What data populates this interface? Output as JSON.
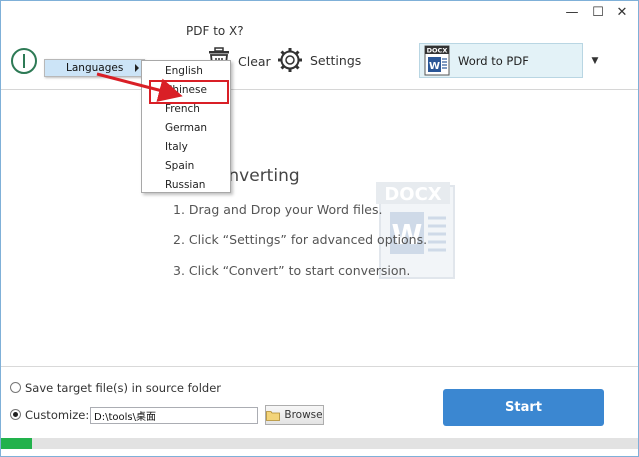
{
  "window": {
    "title": "PDF to X?",
    "minimize_label": "—",
    "maximize_label": "☐",
    "close_label": "✕"
  },
  "toolbar": {
    "clear_label": "Clear",
    "settings_label": "Settings",
    "conversion_selected": "Word to PDF",
    "conversion_icon_text": "DOCX",
    "dropdown_arrow": "▼"
  },
  "menu": {
    "languages_label": "Languages",
    "languages": [
      "English",
      "Chinese",
      "French",
      "German",
      "Italy",
      "Spain",
      "Russian"
    ],
    "highlighted": "Chinese"
  },
  "instructions": {
    "title": "onverting",
    "steps": [
      "1. Drag and Drop your Word files.",
      "2. Click “Settings” for advanced options.",
      "3. Click “Convert” to start conversion."
    ],
    "watermark_text": "DOCX"
  },
  "output": {
    "source_folder_label": "Save target file(s) in source folder",
    "customize_label": "Customize:",
    "customize_selected": true,
    "path_value": "D:\\tools\\桌面",
    "browse_label": "Browse"
  },
  "start_label": "Start",
  "progress": 0.05,
  "colors": {
    "accent": "#3b87d1",
    "progress": "#22b24c",
    "highlight": "#d91f26",
    "menu_hover": "#cce4f7"
  }
}
